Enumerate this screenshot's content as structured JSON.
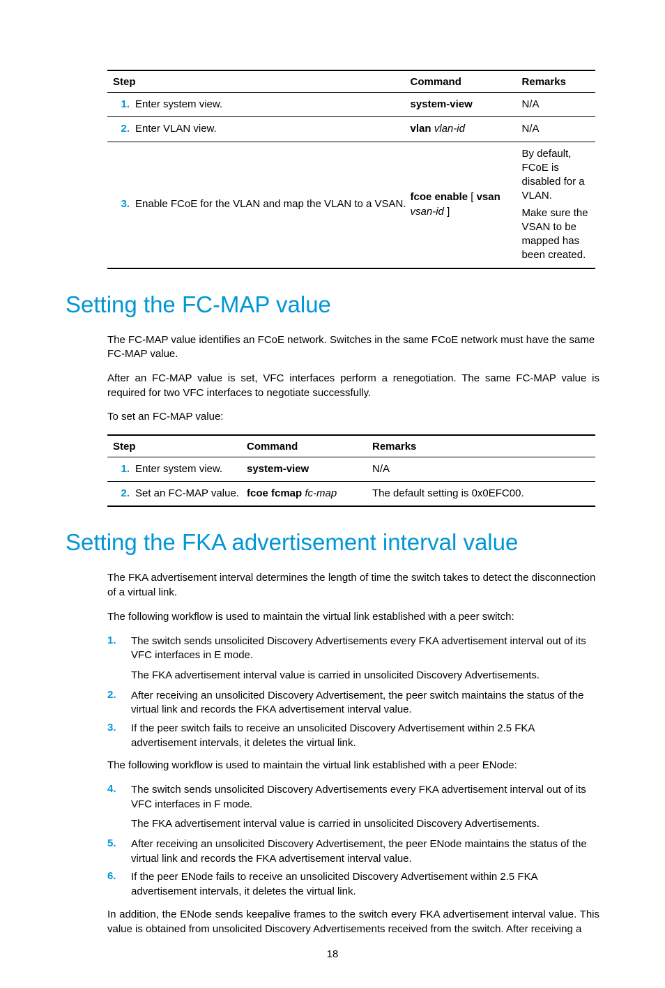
{
  "table1": {
    "headers": {
      "step": "Step",
      "command": "Command",
      "remarks": "Remarks"
    },
    "rows": [
      {
        "num": "1.",
        "step": "Enter system view.",
        "cmd_bold": "system-view",
        "cmd_ital": "",
        "remarks": "N/A"
      },
      {
        "num": "2.",
        "step": "Enter VLAN view.",
        "cmd_bold": "vlan",
        "cmd_ital": "vlan-id",
        "remarks": "N/A"
      },
      {
        "num": "3.",
        "step": "Enable FCoE for the VLAN and map the VLAN to a VSAN.",
        "cmd_bold_a": "fcoe enable",
        "cmd_plain_a": " [ ",
        "cmd_bold_b": "vsan",
        "cmd_ital": "vsan-id",
        "cmd_plain_b": " ]",
        "remarks_a": "By default, FCoE is disabled for a VLAN.",
        "remarks_b": "Make sure the VSAN to be mapped has been created."
      }
    ]
  },
  "section1": {
    "title": "Setting the FC-MAP value",
    "p1": "The FC-MAP value identifies an FCoE network. Switches in the same FCoE network must have the same FC-MAP value.",
    "p2": "After an FC-MAP value is set, VFC interfaces perform a renegotiation. The same FC-MAP value is required for two VFC interfaces to negotiate successfully.",
    "p3": "To set an FC-MAP value:"
  },
  "table2": {
    "headers": {
      "step": "Step",
      "command": "Command",
      "remarks": "Remarks"
    },
    "rows": [
      {
        "num": "1.",
        "step": "Enter system view.",
        "cmd_bold": "system-view",
        "cmd_ital": "",
        "remarks": "N/A"
      },
      {
        "num": "2.",
        "step": "Set an FC-MAP value.",
        "cmd_bold": "fcoe fcmap",
        "cmd_ital": "fc-map",
        "remarks": "The default setting is 0x0EFC00."
      }
    ]
  },
  "section2": {
    "title": "Setting the FKA advertisement interval value",
    "p1": "The FKA advertisement interval determines the length of time the switch takes to detect the disconnection of a virtual link.",
    "p2": "The following workflow is used to maintain the virtual link established with a peer switch:",
    "list1": [
      {
        "num": "1.",
        "text": "The switch sends unsolicited Discovery Advertisements every FKA advertisement interval out of its VFC interfaces in E mode.",
        "sub": "The FKA advertisement interval value is carried in unsolicited Discovery Advertisements."
      },
      {
        "num": "2.",
        "text": "After receiving an unsolicited Discovery Advertisement, the peer switch maintains the status of the virtual link and records the FKA advertisement interval value."
      },
      {
        "num": "3.",
        "text": "If the peer switch fails to receive an unsolicited Discovery Advertisement within 2.5 FKA advertisement intervals, it deletes the virtual link."
      }
    ],
    "p3": "The following workflow is used to maintain the virtual link established with a peer ENode:",
    "list2": [
      {
        "num": "4.",
        "text": "The switch sends unsolicited Discovery Advertisements every FKA advertisement interval out of its VFC interfaces in F mode.",
        "sub": "The FKA advertisement interval value is carried in unsolicited Discovery Advertisements."
      },
      {
        "num": "5.",
        "text": "After receiving an unsolicited Discovery Advertisement, the peer ENode maintains the status of the virtual link and records the FKA advertisement interval value."
      },
      {
        "num": "6.",
        "text": "If the peer ENode fails to receive an unsolicited Discovery Advertisement within 2.5 FKA advertisement intervals, it deletes the virtual link."
      }
    ],
    "p4": "In addition, the ENode sends keepalive frames to the switch every FKA advertisement interval value. This value is obtained from unsolicited Discovery Advertisements received from the switch. After receiving a"
  },
  "page_number": "18"
}
